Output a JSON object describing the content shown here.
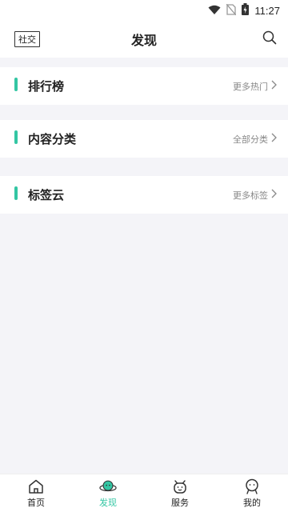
{
  "status_bar": {
    "time": "11:27"
  },
  "header": {
    "title": "发现",
    "social_label": "社交"
  },
  "sections": [
    {
      "title": "排行榜",
      "more": "更多热门"
    },
    {
      "title": "内容分类",
      "more": "全部分类"
    },
    {
      "title": "标签云",
      "more": "更多标签"
    }
  ],
  "bottom_nav": [
    {
      "label": "首页",
      "icon": "home-icon"
    },
    {
      "label": "发现",
      "icon": "planet-icon",
      "active": true
    },
    {
      "label": "服务",
      "icon": "service-icon"
    },
    {
      "label": "我的",
      "icon": "profile-icon"
    }
  ],
  "colors": {
    "accent": "#33c6a3",
    "background": "#f4f4f8",
    "text": "#222222",
    "muted": "#888888"
  }
}
